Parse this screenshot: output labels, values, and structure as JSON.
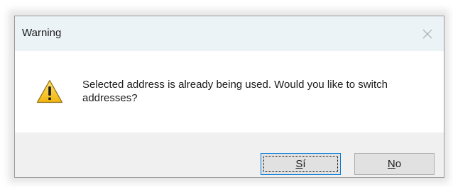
{
  "window": {
    "title": "Warning"
  },
  "dialog": {
    "icon": "warning-triangle-icon",
    "message": "Selected address is already being used. Would you like to switch addresses?"
  },
  "buttons": {
    "yes": {
      "mnemonic": "S",
      "rest": "í"
    },
    "no": {
      "mnemonic": "N",
      "rest": "o"
    }
  },
  "colors": {
    "title_bar": "#ecf3f7",
    "footer": "#f0f0f0",
    "focus_border": "#0078d7",
    "warning_fill": "#f7c325"
  }
}
